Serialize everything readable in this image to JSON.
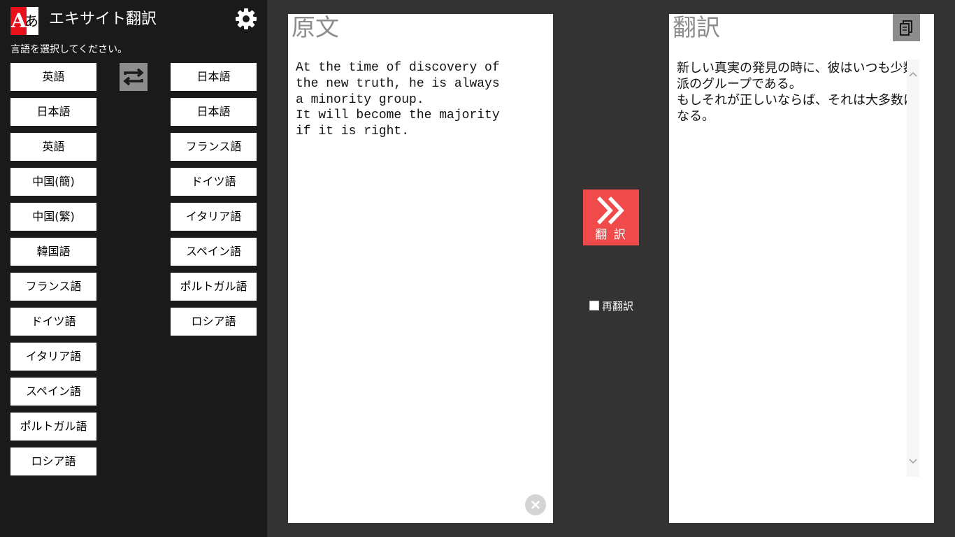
{
  "app": {
    "title": "エキサイト翻訳",
    "logo_text_a": "A",
    "logo_text_ja": "あ",
    "prompt": "言語を選択してください。"
  },
  "source_languages": [
    "英語",
    "日本語",
    "英語",
    "中国(簡)",
    "中国(繁)",
    "韓国語",
    "フランス語",
    "ドイツ語",
    "イタリア語",
    "スペイン語",
    "ポルトガル語",
    "ロシア語"
  ],
  "target_languages": [
    "日本語",
    "日本語",
    "フランス語",
    "ドイツ語",
    "イタリア語",
    "スペイン語",
    "ポルトガル語",
    "ロシア語"
  ],
  "source": {
    "heading": "原文",
    "text": "At the time of discovery of\nthe new truth, he is always\na minority group.\nIt will become the majority\nif it is right."
  },
  "translate_button": {
    "label": "翻 訳"
  },
  "retranslate": {
    "label": "再翻訳",
    "checked": false
  },
  "output": {
    "heading": "翻訳",
    "text": "新しい真実の発見の時に、彼はいつも少数派のグループである。\nもしそれが正しいならば、それは大多数になる。"
  },
  "colors": {
    "accent": "#f04a4a",
    "sidebar": "#1a1a1a",
    "background": "#333333",
    "muted": "#8c8c8c"
  }
}
